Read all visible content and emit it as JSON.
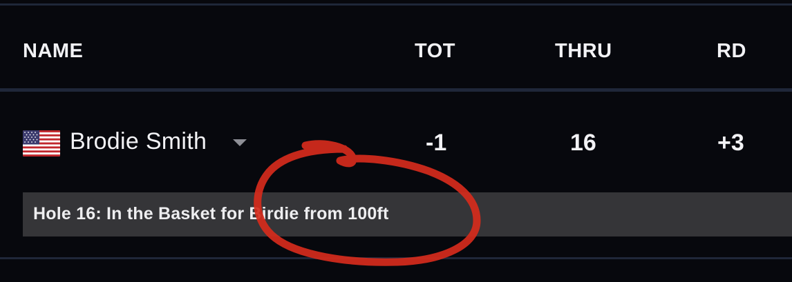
{
  "leaderboard": {
    "headers": {
      "name": "NAME",
      "tot": "TOT",
      "thru": "THRU",
      "rd": "RD"
    },
    "player": {
      "name": "Brodie Smith",
      "flag": "us-flag-icon",
      "tot": "-1",
      "thru": "16",
      "rd": "+3"
    },
    "update": {
      "text": "Hole 16: In the Basket for Birdie from 100ft"
    }
  },
  "colors": {
    "background": "#07080d",
    "divider": "#1f2739",
    "update_bar": "#353538",
    "annotation": "#d62b1c"
  }
}
